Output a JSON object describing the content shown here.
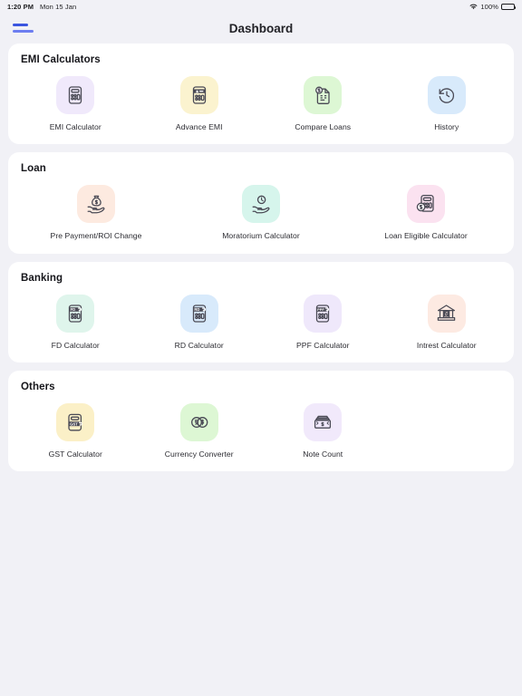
{
  "statusbar": {
    "time": "1:20 PM",
    "date": "Mon 15 Jan",
    "wifi_icon": "wifi-icon",
    "battery_percent": "100%",
    "battery_icon": "battery-full-icon"
  },
  "appbar": {
    "menu_icon": "hamburger-menu-icon",
    "title": "Dashboard",
    "menu_color": "#3b55e0"
  },
  "colors": {
    "page_background": "#f1f1f6",
    "card_background": "#ffffff",
    "title_text": "#15151a",
    "label_text": "#2b2b31",
    "icon_stroke": "#4a4a55"
  },
  "sections": [
    {
      "title": "EMI Calculators",
      "columns": 4,
      "items": [
        {
          "label": "EMI Calculator",
          "icon": "calculator-icon",
          "bg": "#f0e9fb"
        },
        {
          "label": "Advance EMI",
          "icon": "calculator-star-icon",
          "bg": "#fbf3cf"
        },
        {
          "label": "Compare Loans",
          "icon": "document-dollar-icon",
          "bg": "#ddf7d4"
        },
        {
          "label": "History",
          "icon": "clock-rewind-icon",
          "bg": "#d8eafb"
        }
      ]
    },
    {
      "title": "Loan",
      "columns": 3,
      "items": [
        {
          "label": "Pre Payment/ROI Change",
          "icon": "hand-money-bag-icon",
          "bg": "#fdeae0"
        },
        {
          "label": "Moratorium Calculator",
          "icon": "hand-clock-icon",
          "bg": "#d6f5ec"
        },
        {
          "label": "Loan Eligible Calculator",
          "icon": "calculator-coin-icon",
          "bg": "#fbe2f0"
        }
      ]
    },
    {
      "title": "Banking",
      "columns": 4,
      "items": [
        {
          "label": "FD Calculator",
          "icon": "calculator-fd-icon",
          "bg": "#dff5ec"
        },
        {
          "label": "RD Calculator",
          "icon": "calculator-rd-icon",
          "bg": "#d8eafb"
        },
        {
          "label": "PPF Calculator",
          "icon": "calculator-ppf-icon",
          "bg": "#efe8fb"
        },
        {
          "label": "Intrest Calculator",
          "icon": "bank-percent-icon",
          "bg": "#fdeae2"
        }
      ]
    },
    {
      "title": "Others",
      "columns": 4,
      "items": [
        {
          "label": "GST Calculator",
          "icon": "calculator-gst-icon",
          "bg": "#fbf0c7"
        },
        {
          "label": "Currency Converter",
          "icon": "coins-exchange-icon",
          "bg": "#ddf7d4"
        },
        {
          "label": "Note Count",
          "icon": "money-stack-icon",
          "bg": "#f1e9fb"
        }
      ]
    }
  ]
}
